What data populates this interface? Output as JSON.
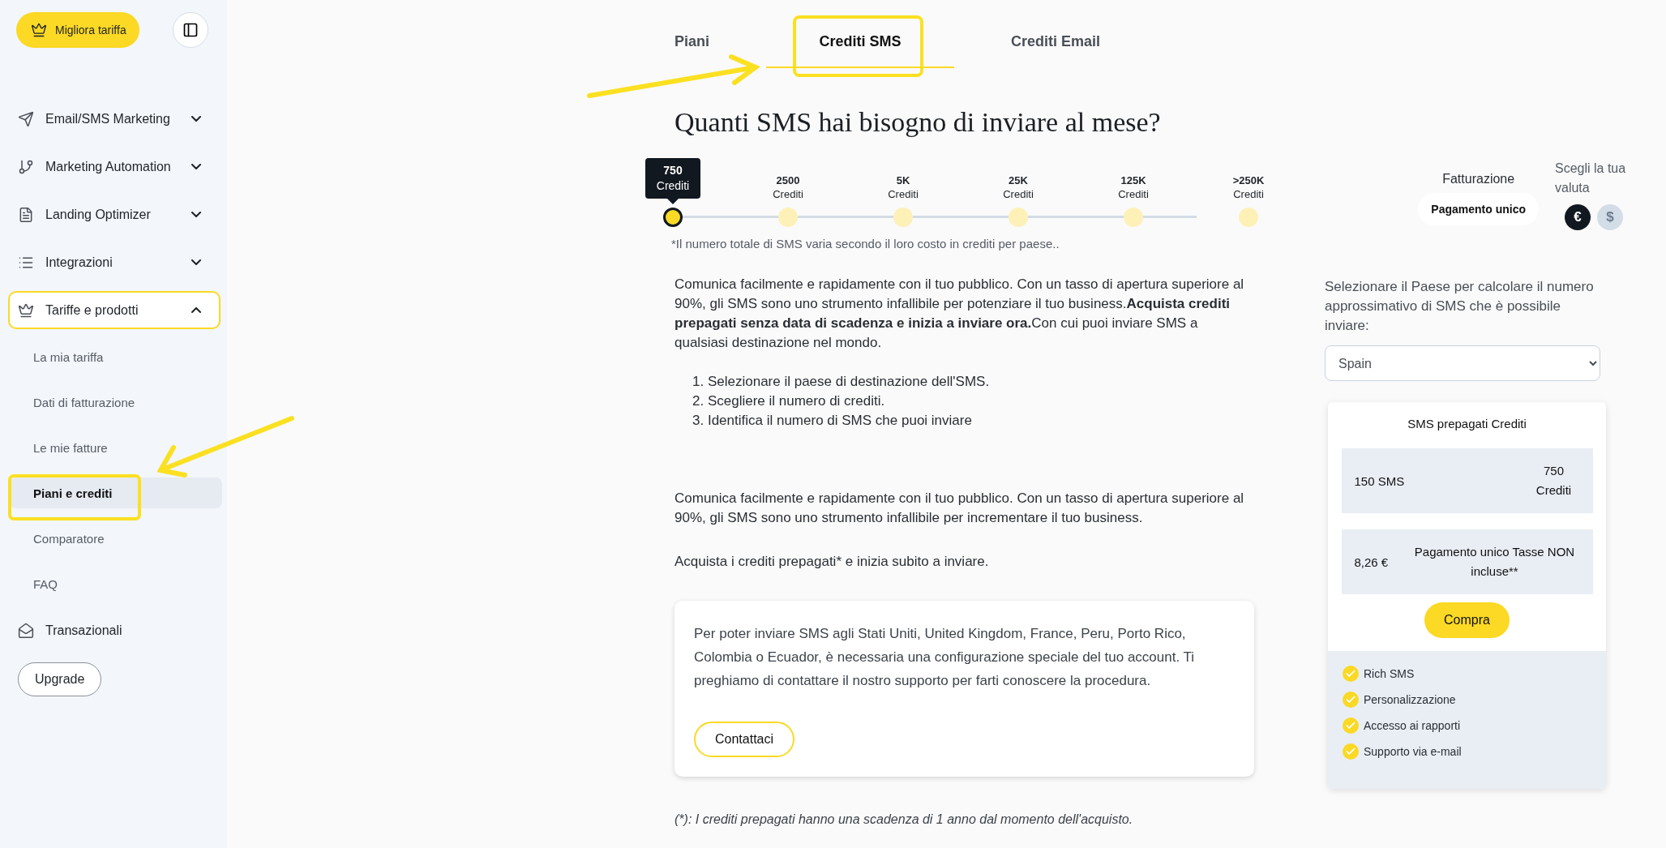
{
  "sidebar": {
    "upgrade_plan_button": "Migliora tariffa",
    "nav": [
      {
        "label": "Email/SMS Marketing",
        "kind": "group",
        "expanded": false
      },
      {
        "label": "Marketing Automation",
        "kind": "group",
        "expanded": false
      },
      {
        "label": "Landing Optimizer",
        "kind": "group",
        "expanded": false
      },
      {
        "label": "Integrazioni",
        "kind": "group",
        "expanded": false
      },
      {
        "label": "Tariffe e prodotti",
        "kind": "group",
        "expanded": true,
        "children": [
          {
            "label": "La mia tariffa",
            "selected": false
          },
          {
            "label": "Dati di fatturazione",
            "selected": false
          },
          {
            "label": "Le mie fatture",
            "selected": false
          },
          {
            "label": "Piani e crediti",
            "selected": true
          },
          {
            "label": "Comparatore",
            "selected": false
          },
          {
            "label": "FAQ",
            "selected": false
          }
        ]
      },
      {
        "label": "Transazionali",
        "kind": "link"
      }
    ],
    "upgrade_button": "Upgrade"
  },
  "tabs": [
    {
      "label": "Piani",
      "selected": false
    },
    {
      "label": "Crediti SMS",
      "selected": true
    },
    {
      "label": "Crediti Email",
      "selected": false
    }
  ],
  "heading": "Quanti SMS hai bisogno di inviare al mese?",
  "slider": {
    "steps": [
      {
        "value": "750",
        "unit": "Crediti",
        "selected": true
      },
      {
        "value": "2500",
        "unit": "Crediti",
        "selected": false
      },
      {
        "value": "5K",
        "unit": "Crediti",
        "selected": false
      },
      {
        "value": "25K",
        "unit": "Crediti",
        "selected": false
      },
      {
        "value": "125K",
        "unit": "Crediti",
        "selected": false
      },
      {
        "value": ">250K",
        "unit": "Crediti",
        "selected": false
      }
    ],
    "note": "*Il numero totale di SMS varia secondo il loro costo in crediti per paese.."
  },
  "intro": "Comunica facilmente e rapidamente con il tuo pubblico. Con un tasso di apertura superiore al 90%, gli SMS sono uno strumento infallibile per potenziare il tuo business.**Acquista crediti prepagati senza data di scadenza e inizia a inviare ora.**Con cui puoi inviare SMS a qualsiasi destinazione nel mondo.",
  "steps": [
    {
      "number": "1.",
      "text": "Selezionare il paese di destinazione dell'SMS."
    },
    {
      "number": "2.",
      "text": "Scegliere il numero di crediti."
    },
    {
      "number": "3.",
      "text": "Identifica il numero di SMS che puoi inviare"
    }
  ],
  "paragraphs": [
    "Comunica facilmente e rapidamente con il tuo pubblico. Con un tasso di apertura superiore al 90%, gli SMS sono uno strumento infallibile per incrementare il tuo business.",
    "Acquista i crediti prepagati* e inizia subito a inviare."
  ],
  "notice": {
    "text": "Per poter inviare SMS agli Stati Uniti, United Kingdom, France, Peru, Porto Rico, Colombia o Ecuador, è necessaria una configurazione speciale del tuo account. Ti preghiamo di contattare il nostro supporto per farti conoscere la procedura.",
    "button": "Contattaci"
  },
  "footnote": "(*): I crediti prepagati hanno una scadenza di 1 anno dal momento dell'acquisto.",
  "billing": {
    "label": "Fatturazione",
    "option": "Pagamento unico"
  },
  "currency": {
    "label": "Scegli la tua valuta",
    "options": [
      {
        "symbol": "€",
        "selected": true
      },
      {
        "symbol": "$",
        "selected": false
      }
    ]
  },
  "country": {
    "label": "Selezionare il Paese per calcolare il numero approssimativo di SMS che è possibile inviare:",
    "value": "Spain"
  },
  "plan_card": {
    "title": "SMS prepagati Crediti",
    "rows": [
      {
        "left": "150 SMS",
        "right": "750 Crediti"
      },
      {
        "left": "8,26 €",
        "right": "Pagamento unico Tasse NON incluse**"
      }
    ],
    "buy_button": "Compra",
    "features": [
      "Rich SMS",
      "Personalizzazione",
      "Accesso ai rapporti",
      "Supporto via e-mail"
    ]
  }
}
